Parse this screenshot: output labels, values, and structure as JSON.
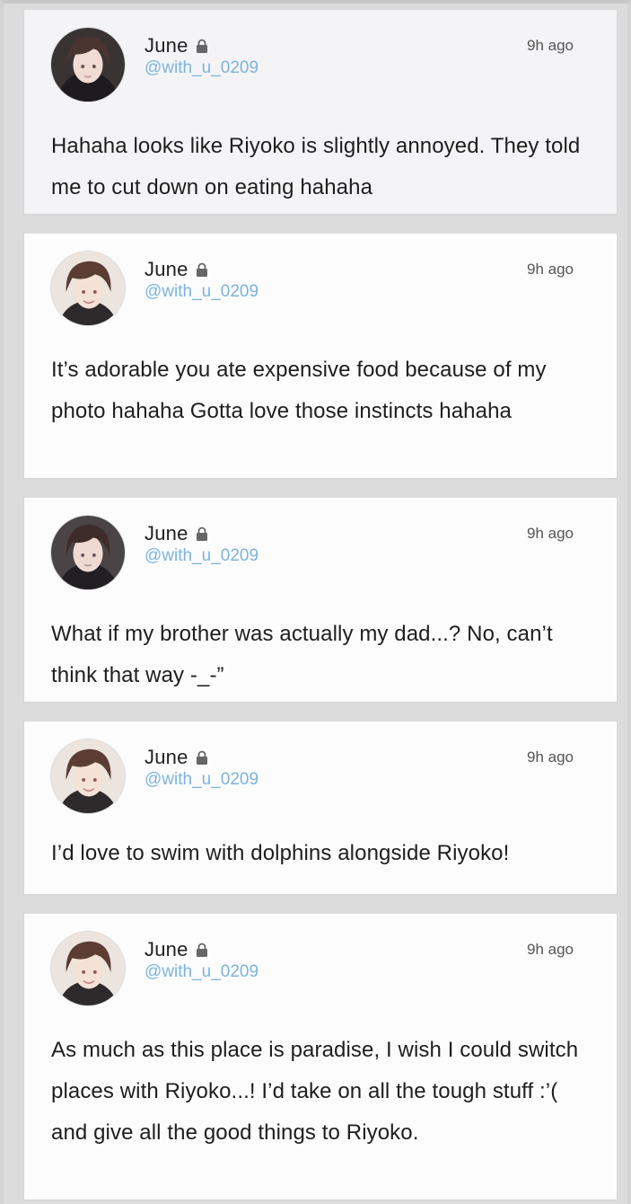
{
  "posts": [
    {
      "author": "June",
      "handle": "@with_u_0209",
      "time": "9h ago",
      "text": "Hahaha looks like Riyoko is slightly annoyed. They told me to cut down on eating hahaha",
      "avatar_icon": "profile-avatar-dark-hair"
    },
    {
      "author": "June",
      "handle": "@with_u_0209",
      "time": "9h ago",
      "text": "It’s adorable you ate expensive food because of my photo hahaha Gotta love those instincts hahaha",
      "avatar_icon": "profile-avatar-smiling"
    },
    {
      "author": "June",
      "handle": "@with_u_0209",
      "time": "9h ago",
      "text": "What if my brother was actually my dad...? No, can’t think that way -_-”",
      "avatar_icon": "profile-avatar-dark-hair"
    },
    {
      "author": "June",
      "handle": "@with_u_0209",
      "time": "9h ago",
      "text": "I’d love to swim with dolphins alongside Riyoko!",
      "avatar_icon": "profile-avatar-smiling"
    },
    {
      "author": "June",
      "handle": "@with_u_0209",
      "time": "9h ago",
      "text": "As much as this place is paradise, I wish I could switch places with Riyoko...! I’d take on all the tough stuff :’( and give all the good things to Riyoko.",
      "avatar_icon": "profile-avatar-smiling"
    }
  ],
  "colors": {
    "background": "#dcdcdc",
    "card": "#fcfcfd",
    "handle": "#7cb4dc",
    "text": "#1e1e1e"
  }
}
